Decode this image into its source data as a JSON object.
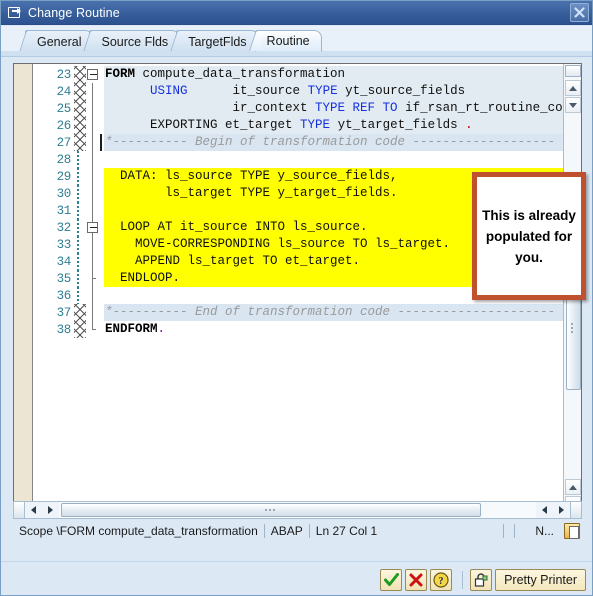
{
  "window": {
    "title": "Change Routine",
    "icon": "window-restore-icon",
    "close_label": "✕"
  },
  "tabs": [
    {
      "label": "General",
      "active": false
    },
    {
      "label": "Source Flds",
      "active": false
    },
    {
      "label": "TargetFlds",
      "active": false
    },
    {
      "label": "Routine",
      "active": true
    }
  ],
  "editor": {
    "first_line": 23,
    "lines": [
      {
        "no": "23",
        "gutter": "hatch",
        "fold": "start",
        "bg": "head",
        "bar": false,
        "segments": [
          {
            "t": "FORM ",
            "c": "kw-bold"
          },
          {
            "t": "compute_data_transformation",
            "c": ""
          }
        ]
      },
      {
        "no": "24",
        "gutter": "hatch",
        "fold": "line",
        "bg": "head",
        "bar": false,
        "segments": [
          {
            "t": "      USING      it_source ",
            "c": ""
          },
          {
            "t": "",
            "c": ""
          }
        ],
        "rich": [
          {
            "t": "      ",
            "c": ""
          },
          {
            "t": "USING",
            "c": "kw-blue"
          },
          {
            "t": "      it_source ",
            "c": ""
          },
          {
            "t": "TYPE",
            "c": "kw-blue"
          },
          {
            "t": " yt_source_fields",
            "c": ""
          }
        ]
      },
      {
        "no": "25",
        "gutter": "hatch",
        "fold": "line",
        "bg": "head",
        "bar": false,
        "rich": [
          {
            "t": "                 ir_context ",
            "c": ""
          },
          {
            "t": "TYPE REF TO",
            "c": "kw-blue"
          },
          {
            "t": " if_rsan_rt_routine_co",
            "c": ""
          }
        ]
      },
      {
        "no": "26",
        "gutter": "hatch",
        "fold": "line",
        "bg": "head",
        "bar": false,
        "rich": [
          {
            "t": "      EXPORTING et_target ",
            "c": ""
          },
          {
            "t": "TYPE",
            "c": "kw-blue"
          },
          {
            "t": " yt_target_fields ",
            "c": ""
          },
          {
            "t": ".",
            "c": "dot-red"
          }
        ]
      },
      {
        "no": "27",
        "gutter": "hatch",
        "fold": "line",
        "bg": "sel",
        "bar": true,
        "rich": [
          {
            "t": "*---------- Begin of transformation code -------------------",
            "c": "cmt"
          }
        ]
      },
      {
        "no": "28",
        "gutter": "dotted",
        "fold": "line",
        "bg": "white",
        "bar": false,
        "rich": []
      },
      {
        "no": "29",
        "gutter": "dotted",
        "fold": "line",
        "bg": "yel",
        "bar": false,
        "rich": [
          {
            "t": "  DATA: ls_source TYPE y_source_fields,",
            "c": ""
          }
        ]
      },
      {
        "no": "30",
        "gutter": "dotted",
        "fold": "line",
        "bg": "yel",
        "bar": false,
        "rich": [
          {
            "t": "        ls_target TYPE y_target_fields.",
            "c": ""
          }
        ]
      },
      {
        "no": "31",
        "gutter": "dotted",
        "fold": "line",
        "bg": "yel",
        "bar": false,
        "rich": []
      },
      {
        "no": "32",
        "gutter": "dotted",
        "fold": "box",
        "bg": "yel",
        "bar": false,
        "rich": [
          {
            "t": "  LOOP AT it_source INTO ls_source.",
            "c": ""
          }
        ]
      },
      {
        "no": "33",
        "gutter": "dotted",
        "fold": "line",
        "bg": "yel",
        "bar": false,
        "rich": [
          {
            "t": "    MOVE-CORRESPONDING ls_source TO ls_target.",
            "c": ""
          }
        ]
      },
      {
        "no": "34",
        "gutter": "dotted",
        "fold": "line",
        "bg": "yel",
        "bar": false,
        "rich": [
          {
            "t": "    APPEND ls_target TO et_target.",
            "c": ""
          }
        ]
      },
      {
        "no": "35",
        "gutter": "dotted",
        "fold": "end",
        "bg": "yel",
        "bar": false,
        "rich": [
          {
            "t": "  ENDLOOP.",
            "c": ""
          }
        ]
      },
      {
        "no": "36",
        "gutter": "dotted",
        "fold": "line",
        "bg": "white",
        "bar": false,
        "rich": []
      },
      {
        "no": "37",
        "gutter": "hatch",
        "fold": "line",
        "bg": "sel",
        "bar": false,
        "rich": [
          {
            "t": "*---------- End of transformation code ---------------------",
            "c": "cmt"
          }
        ]
      },
      {
        "no": "38",
        "gutter": "hatch",
        "fold": "endform",
        "bg": "white",
        "bar": false,
        "rich": [
          {
            "t": "ENDFORM",
            "c": "kw-bold"
          },
          {
            "t": ".",
            "c": "dot-pur"
          }
        ]
      }
    ]
  },
  "callout": {
    "text": "This is already populated for you.",
    "border_color": "#c0512f"
  },
  "status": {
    "scope": "Scope \\FORM compute_data_transformation",
    "language": "ABAP",
    "position": "Ln  27 Col  1",
    "mode": "N...",
    "icon": "clipboard-icon"
  },
  "toolbar": {
    "confirm_label": "✔",
    "cancel_label": "✖",
    "help_label": "?",
    "lock_icon": "unlock-icon",
    "pretty_printer_label": "Pretty Printer"
  },
  "scrollbars": {
    "vertical_split": "split-handle",
    "up_arrow": "arrow-up-icon",
    "down_arrow": "arrow-down-icon",
    "left_arrow": "arrow-left-icon",
    "right_arrow": "arrow-right-icon"
  }
}
